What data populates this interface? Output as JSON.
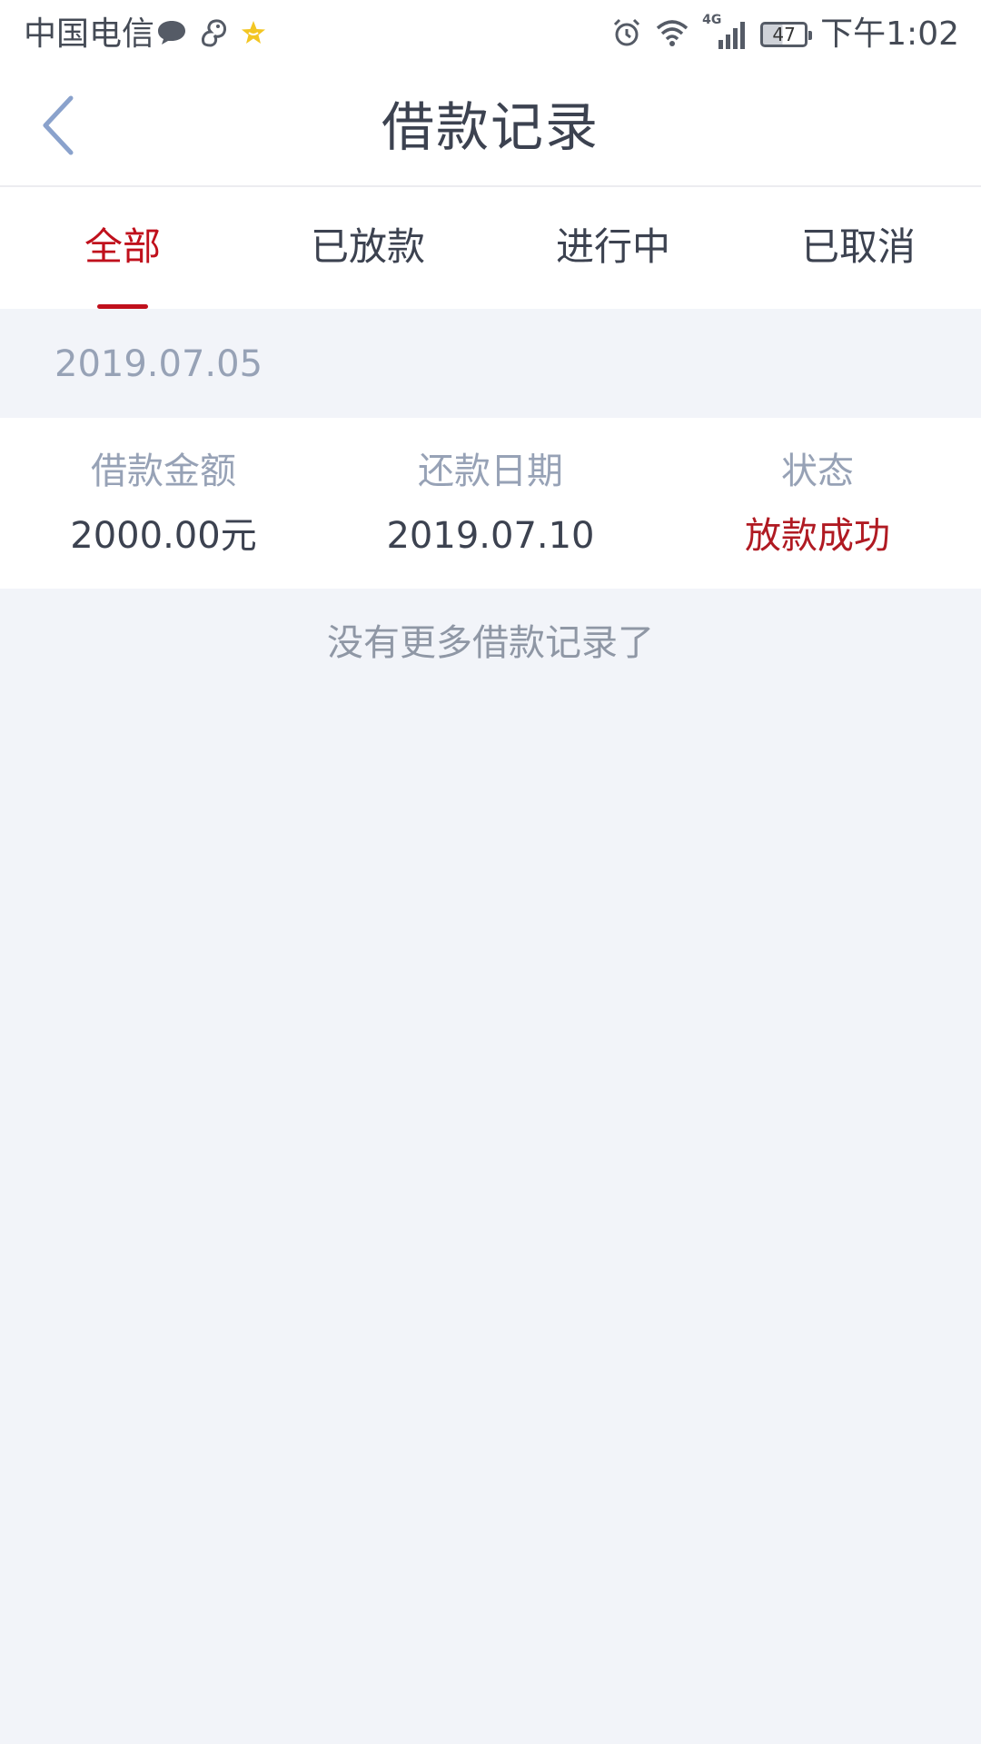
{
  "status_bar": {
    "carrier": "中国电信",
    "left_icons": [
      "chat-bubble-icon",
      "squirrel-icon",
      "star-badge-icon"
    ],
    "right_icons": [
      "alarm-icon",
      "wifi-icon",
      "signal-4g-icon"
    ],
    "network_label": "4G",
    "battery": "47",
    "time": "下午1:02"
  },
  "nav": {
    "title": "借款记录",
    "back_icon": "chevron-left-icon"
  },
  "tabs": [
    {
      "label": "全部",
      "active": true
    },
    {
      "label": "已放款",
      "active": false
    },
    {
      "label": "进行中",
      "active": false
    },
    {
      "label": "已取消",
      "active": false
    }
  ],
  "records": [
    {
      "date": "2019.07.05",
      "columns": [
        {
          "label": "借款金额",
          "value": "2000.00元"
        },
        {
          "label": "还款日期",
          "value": "2019.07.10"
        },
        {
          "label": "状态",
          "value": "放款成功"
        }
      ]
    }
  ],
  "footer": {
    "no_more_text": "没有更多借款记录了"
  },
  "colors": {
    "accent_red": "#c0101c",
    "status_success": "#b01a22",
    "muted_text": "#97a2b6",
    "background": "#f2f4f9"
  }
}
